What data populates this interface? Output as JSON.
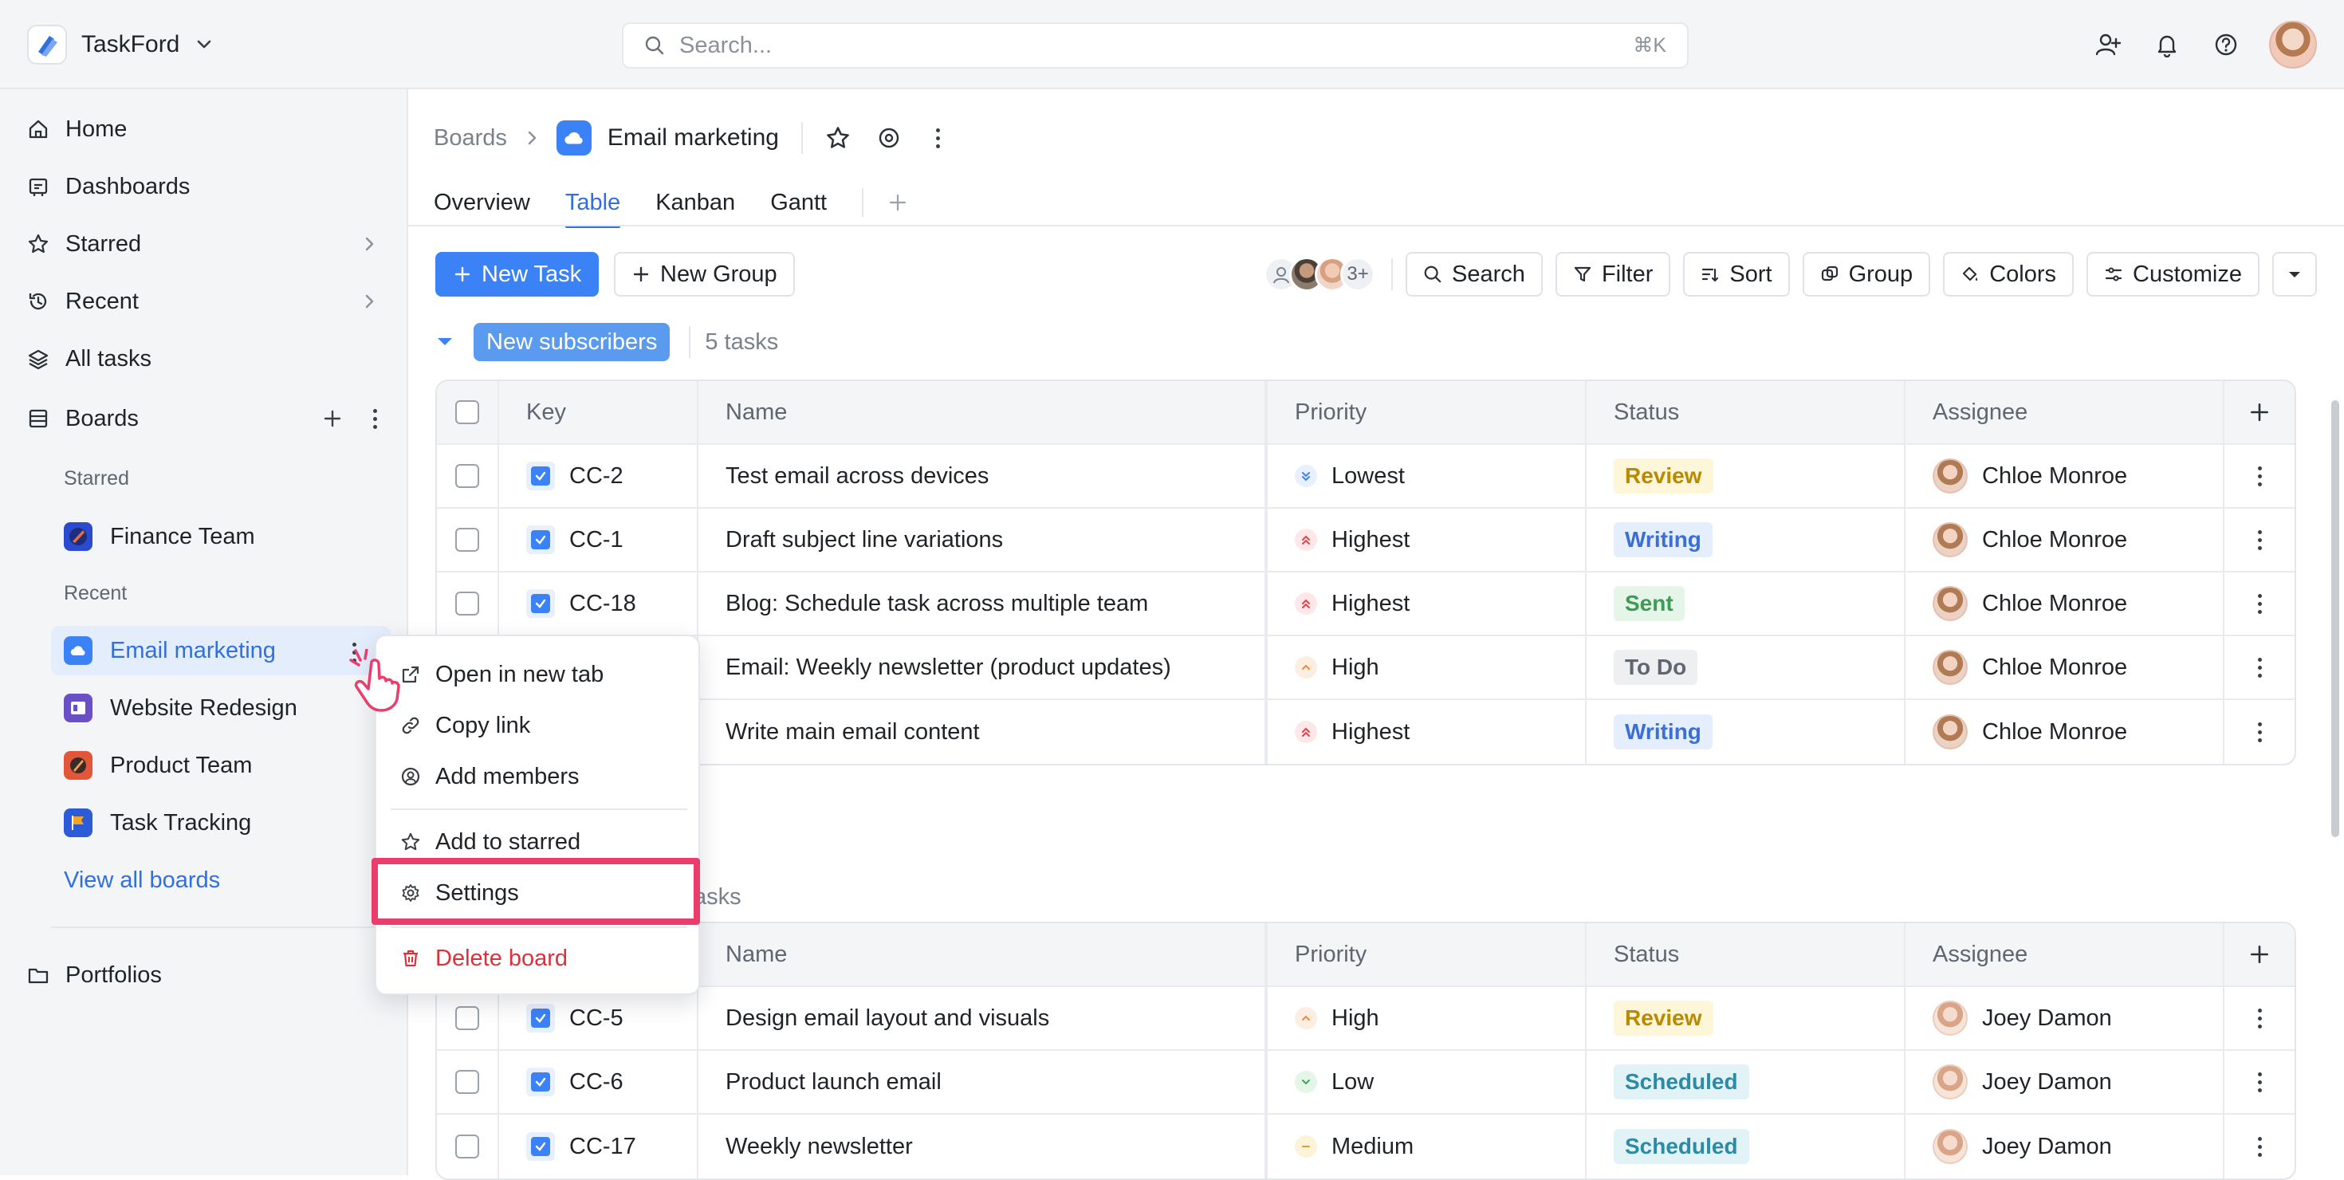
{
  "app": {
    "name": "TaskFord"
  },
  "search": {
    "placeholder": "Search...",
    "shortcut": "⌘K"
  },
  "sidebar": {
    "nav": [
      {
        "label": "Home"
      },
      {
        "label": "Dashboards"
      },
      {
        "label": "Starred"
      },
      {
        "label": "Recent"
      },
      {
        "label": "All tasks"
      },
      {
        "label": "Boards"
      }
    ],
    "starred_label": "Starred",
    "recent_label": "Recent",
    "starred_boards": [
      {
        "label": "Finance Team"
      }
    ],
    "recent_boards": [
      {
        "label": "Email marketing"
      },
      {
        "label": "Website Redesign"
      },
      {
        "label": "Product Team"
      },
      {
        "label": "Task Tracking"
      }
    ],
    "view_all": "View all boards",
    "portfolios": "Portfolios"
  },
  "breadcrumb": {
    "root": "Boards",
    "title": "Email marketing"
  },
  "tabs": [
    {
      "label": "Overview"
    },
    {
      "label": "Table"
    },
    {
      "label": "Kanban"
    },
    {
      "label": "Gantt"
    }
  ],
  "toolbar": {
    "new_task": "New Task",
    "new_group": "New Group",
    "members_more": "3+",
    "search": "Search",
    "filter": "Filter",
    "sort": "Sort",
    "group": "Group",
    "colors": "Colors",
    "customize": "Customize"
  },
  "columns": {
    "key": "Key",
    "name": "Name",
    "priority": "Priority",
    "status": "Status",
    "assignee": "Assignee"
  },
  "groups": [
    {
      "name": "New subscribers",
      "count": "5 tasks",
      "rows": [
        {
          "key": "CC-2",
          "name": "Test email across devices",
          "priority": "Lowest",
          "status": "Review",
          "assignee": "Chloe Monroe"
        },
        {
          "key": "CC-1",
          "name": "Draft subject line variations",
          "priority": "Highest",
          "status": "Writing",
          "assignee": "Chloe Monroe"
        },
        {
          "key": "CC-18",
          "name": "Blog: Schedule task across multiple team",
          "priority": "Highest",
          "status": "Sent",
          "assignee": "Chloe Monroe"
        },
        {
          "key": "",
          "name": "Email: Weekly newsletter (product updates)",
          "priority": "High",
          "status": "To Do",
          "assignee": "Chloe Monroe"
        },
        {
          "key": "",
          "name": "Write main email content",
          "priority": "Highest",
          "status": "Writing",
          "assignee": "Chloe Monroe"
        }
      ]
    },
    {
      "name": "",
      "count": "5 tasks",
      "rows": [
        {
          "key": "CC-5",
          "name": "Design email layout and visuals",
          "priority": "High",
          "status": "Review",
          "assignee": "Joey Damon"
        },
        {
          "key": "CC-6",
          "name": "Product launch email",
          "priority": "Low",
          "status": "Scheduled",
          "assignee": "Joey Damon"
        },
        {
          "key": "CC-17",
          "name": "Weekly newsletter",
          "priority": "Medium",
          "status": "Scheduled",
          "assignee": "Joey Damon"
        }
      ]
    }
  ],
  "context_menu": {
    "items": [
      {
        "label": "Open in new tab"
      },
      {
        "label": "Copy link"
      },
      {
        "label": "Add members"
      },
      {
        "label": "Add to starred"
      },
      {
        "label": "Settings"
      },
      {
        "label": "Delete board"
      }
    ]
  },
  "colors": {
    "accent": "#3b82f6",
    "highlight": "#ea3d6c",
    "danger": "#d9323a"
  }
}
